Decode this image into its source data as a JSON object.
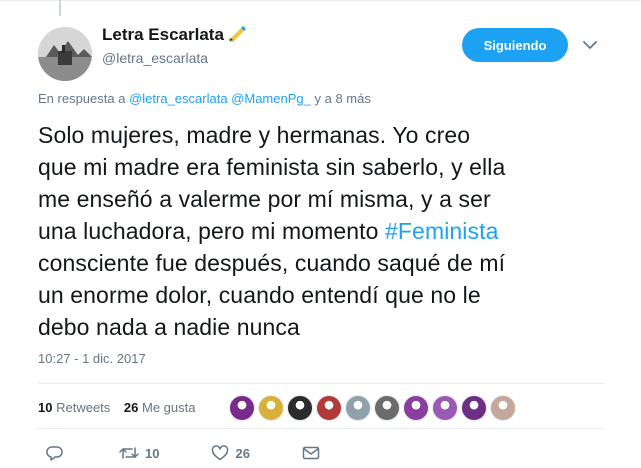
{
  "tweet": {
    "author": {
      "display_name": "Letra Escarlata",
      "screen_name": "@letra_escarlata",
      "name_emoji": "writing-hand-icon"
    },
    "follow_button": {
      "label": "Siguiendo"
    },
    "reply_context": {
      "prefix": "En respuesta a",
      "mentions": [
        "@letra_escarlata",
        "@MamenPg_"
      ],
      "suffix": "y a 8 más"
    },
    "text_lines": [
      {
        "before": "Solo mujeres, madre y hermanas. Yo creo",
        "hashtag": "",
        "after": ""
      },
      {
        "before": "que mi madre era feminista sin saberlo, y ella",
        "hashtag": "",
        "after": ""
      },
      {
        "before": "me enseñó a valerme por mí misma, y a ser",
        "hashtag": "",
        "after": ""
      },
      {
        "before": "una luchadora, pero mi momento ",
        "hashtag": "#Feminista",
        "after": ""
      },
      {
        "before": "consciente fue después, cuando saqué de mí",
        "hashtag": "",
        "after": ""
      },
      {
        "before": "un enorme dolor, cuando entendí que no le",
        "hashtag": "",
        "after": ""
      },
      {
        "before": "debo nada a nadie nunca",
        "hashtag": "",
        "after": ""
      }
    ],
    "timestamp": "10:27 - 1 dic. 2017",
    "stats": {
      "retweets_count": "10",
      "retweets_label": "Retweets",
      "likes_count": "26",
      "likes_label": "Me gusta"
    },
    "liker_avatars": [
      {
        "name": "liker-avatar-1",
        "color": "#7a2a8c"
      },
      {
        "name": "liker-avatar-2",
        "color": "#d9b13a"
      },
      {
        "name": "liker-avatar-3",
        "color": "#2b2b2b"
      },
      {
        "name": "liker-avatar-4",
        "color": "#b03a3a"
      },
      {
        "name": "liker-avatar-5",
        "color": "#8fa0ad"
      },
      {
        "name": "liker-avatar-6",
        "color": "#6b6b6b"
      },
      {
        "name": "liker-avatar-7",
        "color": "#8a3fa0"
      },
      {
        "name": "liker-avatar-8",
        "color": "#9b59b6"
      },
      {
        "name": "liker-avatar-9",
        "color": "#6d2f86"
      },
      {
        "name": "liker-avatar-10",
        "color": "#c4a89a"
      }
    ],
    "actions": {
      "reply_icon": "reply-icon",
      "retweet_icon": "retweet-icon",
      "retweet_count": "10",
      "like_icon": "heart-icon",
      "like_count": "26",
      "dm_icon": "envelope-icon"
    },
    "colors": {
      "accent": "#1da1f2",
      "text_primary": "#14171a",
      "text_secondary": "#657786",
      "divider": "#e6ecf0"
    }
  }
}
